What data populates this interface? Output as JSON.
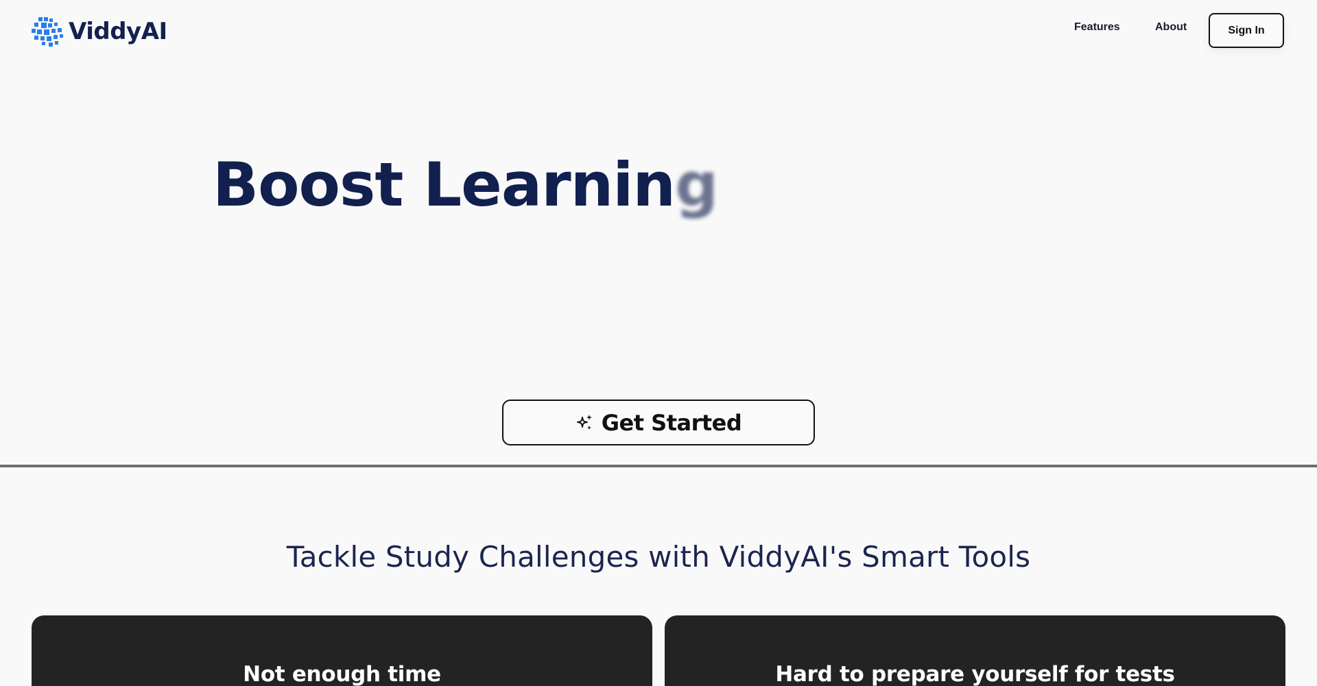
{
  "brand": {
    "name": "ViddyAI",
    "logo_color": "#2b7de9"
  },
  "nav": {
    "features_label": "Features",
    "about_label": "About",
    "signin_label": "Sign In"
  },
  "hero": {
    "title_main": "Boost Learnin",
    "title_fading_char": "g",
    "cta_label": "Get Started",
    "cta_icon": "sparkles-icon"
  },
  "challenges": {
    "heading": "Tackle Study Challenges with ViddyAI's Smart Tools",
    "cards": [
      {
        "title": "Not enough time"
      },
      {
        "title": "Hard to prepare yourself for tests"
      }
    ]
  },
  "colors": {
    "background": "#f9f9f9",
    "navy_text": "#12204f",
    "card_background": "#232323",
    "divider": "#6e6e6e"
  }
}
